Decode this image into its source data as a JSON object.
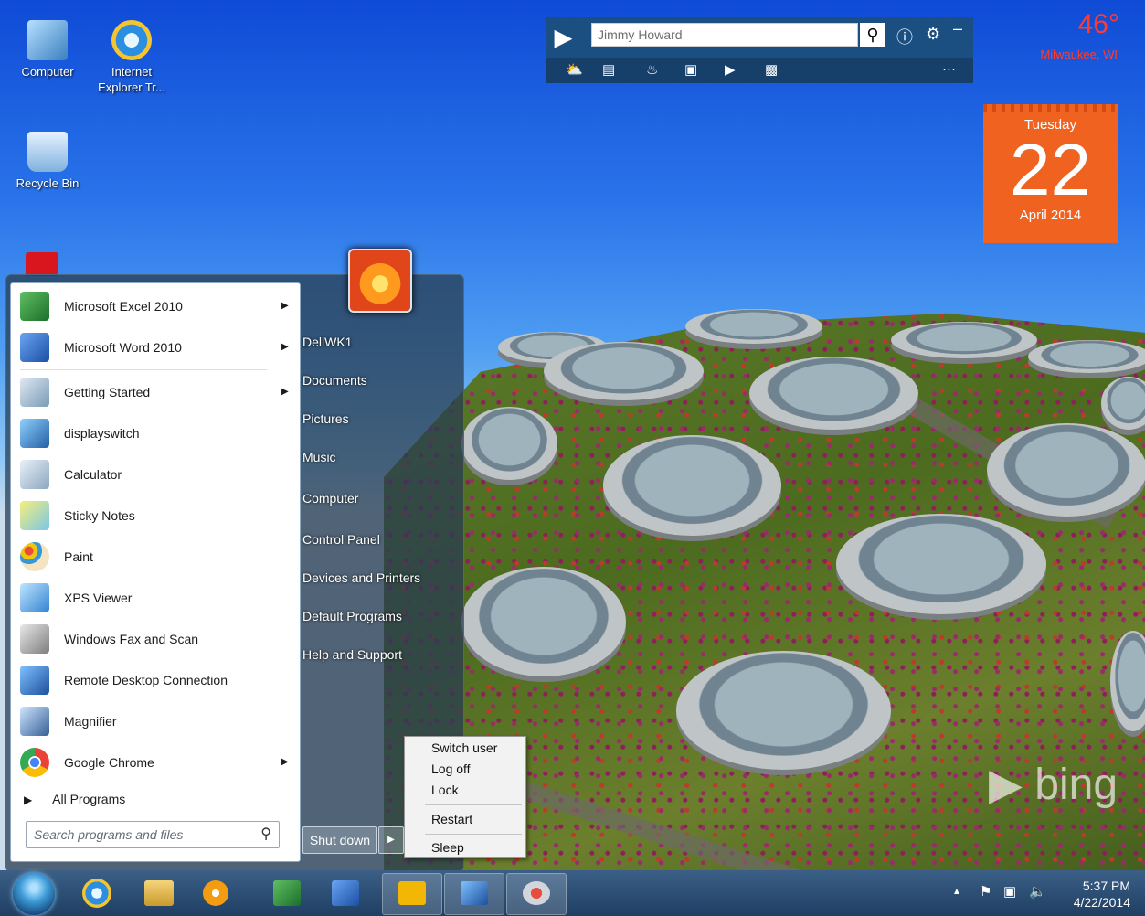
{
  "desktop": {
    "icons": [
      {
        "label": "Computer",
        "icon": "computer-icon"
      },
      {
        "label": "Internet Explorer Tr...",
        "icon": "ie-icon"
      },
      {
        "label": "Recycle Bin",
        "icon": "recycle-bin-icon"
      }
    ],
    "watermark": "bing"
  },
  "bingbar": {
    "search_value": "Jimmy Howard",
    "tools": [
      "weather-icon",
      "news-icon",
      "trending-icon",
      "images-icon",
      "video-icon",
      "facebook-icon"
    ],
    "more_label": "···"
  },
  "weather": {
    "temp": "46°",
    "city": "Milwaukee, WI"
  },
  "calendar": {
    "weekday": "Tuesday",
    "day": "22",
    "month_year": "April 2014"
  },
  "start_menu": {
    "programs": [
      {
        "label": "Microsoft Excel 2010",
        "arrow": true,
        "icon": "excel-icon"
      },
      {
        "label": "Microsoft Word 2010",
        "arrow": true,
        "icon": "word-icon"
      },
      {
        "label": "Getting Started",
        "arrow": true,
        "icon": "getting-started-icon"
      },
      {
        "label": "displayswitch",
        "arrow": false,
        "icon": "displayswitch-icon"
      },
      {
        "label": "Calculator",
        "arrow": false,
        "icon": "calculator-icon"
      },
      {
        "label": "Sticky Notes",
        "arrow": false,
        "icon": "sticky-notes-icon"
      },
      {
        "label": "Paint",
        "arrow": false,
        "icon": "paint-icon"
      },
      {
        "label": "XPS Viewer",
        "arrow": false,
        "icon": "xps-viewer-icon"
      },
      {
        "label": "Windows Fax and Scan",
        "arrow": false,
        "icon": "fax-scan-icon"
      },
      {
        "label": "Remote Desktop Connection",
        "arrow": false,
        "icon": "remote-desktop-icon"
      },
      {
        "label": "Magnifier",
        "arrow": false,
        "icon": "magnifier-icon"
      },
      {
        "label": "Google Chrome",
        "arrow": true,
        "icon": "chrome-icon"
      }
    ],
    "all_programs": "All Programs",
    "search_placeholder": "Search programs and files",
    "right_items": [
      "DellWK1",
      "Documents",
      "Pictures",
      "Music",
      "Computer",
      "Control Panel",
      "Devices and Printers",
      "Default Programs",
      "Help and Support"
    ],
    "shutdown_label": "Shut down",
    "shutdown_submenu": [
      "Switch user",
      "Log off",
      "Lock",
      "Restart",
      "Sleep"
    ]
  },
  "taskbar": {
    "pinned": [
      "ie-icon",
      "explorer-icon",
      "media-player-icon",
      "excel-icon",
      "word-icon",
      "bing-desktop-icon",
      "remote-desktop-icon",
      "snipping-tool-icon"
    ],
    "time": "5:37 PM",
    "date": "4/22/2014"
  },
  "colors": {
    "accent": "#f0621f",
    "weather_text": "#ff3b30",
    "bingbar": "#1b4f82"
  }
}
